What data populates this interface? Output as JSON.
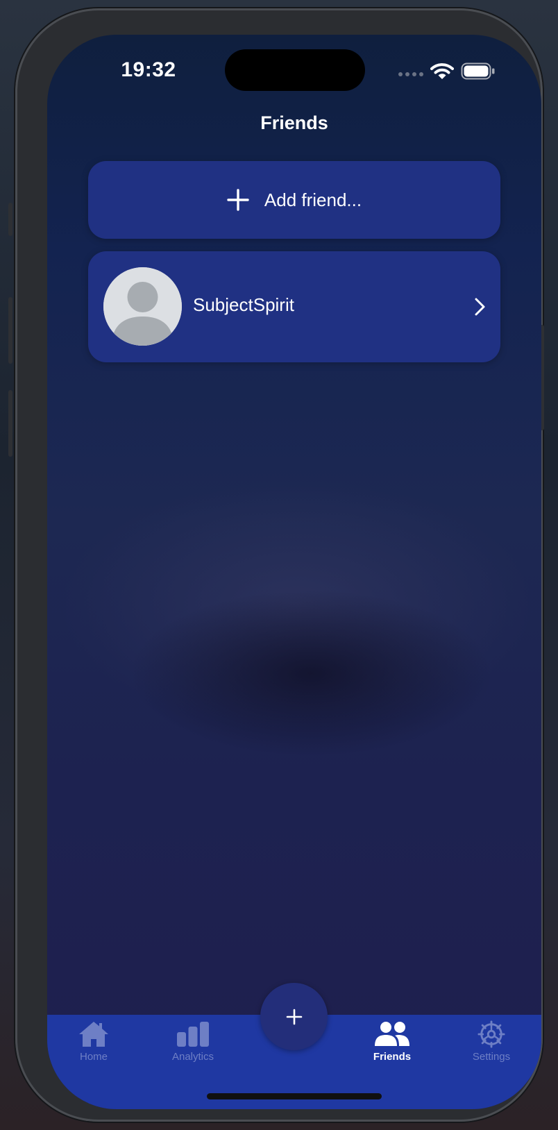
{
  "status_bar": {
    "time": "19:32"
  },
  "header": {
    "title": "Friends"
  },
  "add_friend": {
    "label": "Add friend..."
  },
  "friends": [
    {
      "name": "SubjectSpirit"
    }
  ],
  "tab_bar": {
    "tabs": [
      {
        "label": "Home",
        "icon": "house-icon"
      },
      {
        "label": "Analytics",
        "icon": "bar-chart-icon"
      },
      {
        "label": "Friends",
        "icon": "people-icon",
        "active": true
      },
      {
        "label": "Settings",
        "icon": "gear-icon"
      }
    ],
    "fab_icon": "plus-icon"
  },
  "colors": {
    "card": "#203183",
    "tabbar": "#1f38a2",
    "tab_inactive": "#6e7fc5",
    "tab_active": "#ffffff",
    "fab": "#232e7a"
  }
}
